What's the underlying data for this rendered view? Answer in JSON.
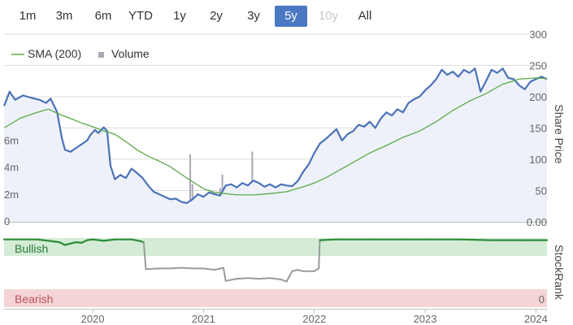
{
  "range_selector": {
    "buttons": [
      "1m",
      "3m",
      "6m",
      "YTD",
      "1y",
      "2y",
      "3y",
      "5y",
      "10y",
      "All"
    ],
    "active": "5y",
    "disabled": [
      "10y"
    ],
    "active_color": "#4a78c2"
  },
  "legend": {
    "sma_label": "SMA (200)",
    "volume_label": "Volume",
    "sma_color": "#5aaa46",
    "volume_color": "#a9aab3"
  },
  "price_axis": {
    "title": "Share Price",
    "ticks": [
      "300",
      "250",
      "200",
      "150",
      "100",
      "50",
      "0.00"
    ]
  },
  "volume_axis": {
    "ticks": [
      "6m",
      "4m",
      "2m",
      "0"
    ]
  },
  "stockrank_panel": {
    "title": "StockRank",
    "bullish_label": "Bullish",
    "bearish_label": "Bearish",
    "min_label": "0",
    "bullish_color": "#d4ecd6",
    "bearish_color": "#f4d4d6",
    "bullish_line_color": "#2e8a3a",
    "bearish_line_color": "#9a9a9a"
  },
  "x_axis": {
    "labels": [
      "2020",
      "2021",
      "2022",
      "2023",
      "2024"
    ]
  },
  "colors": {
    "price_line": "#4a72b8",
    "price_fill": "#eef1f9",
    "grid": "#dcdcdc"
  },
  "chart_data": {
    "type": "line",
    "x_range": [
      2019.2,
      2024.1
    ],
    "price_ylim": [
      0,
      300
    ],
    "volume_ylim": [
      0,
      8000000
    ],
    "stockrank_ylim": [
      0,
      100
    ],
    "series": [
      {
        "name": "Share Price",
        "points": [
          [
            2019.2,
            185
          ],
          [
            2019.25,
            208
          ],
          [
            2019.3,
            195
          ],
          [
            2019.37,
            202
          ],
          [
            2019.45,
            198
          ],
          [
            2019.52,
            195
          ],
          [
            2019.58,
            190
          ],
          [
            2019.62,
            197
          ],
          [
            2019.68,
            175
          ],
          [
            2019.72,
            135
          ],
          [
            2019.75,
            115
          ],
          [
            2019.8,
            112
          ],
          [
            2019.85,
            118
          ],
          [
            2019.9,
            124
          ],
          [
            2019.95,
            130
          ],
          [
            2019.98,
            139
          ],
          [
            2020.02,
            147
          ],
          [
            2020.05,
            142
          ],
          [
            2020.1,
            151
          ],
          [
            2020.13,
            145
          ],
          [
            2020.16,
            90
          ],
          [
            2020.2,
            68
          ],
          [
            2020.25,
            75
          ],
          [
            2020.3,
            70
          ],
          [
            2020.35,
            85
          ],
          [
            2020.4,
            78
          ],
          [
            2020.45,
            70
          ],
          [
            2020.5,
            58
          ],
          [
            2020.55,
            48
          ],
          [
            2020.6,
            44
          ],
          [
            2020.65,
            40
          ],
          [
            2020.7,
            36
          ],
          [
            2020.75,
            37
          ],
          [
            2020.8,
            32
          ],
          [
            2020.85,
            30
          ],
          [
            2020.9,
            36
          ],
          [
            2020.95,
            44
          ],
          [
            2021.0,
            40
          ],
          [
            2021.05,
            47
          ],
          [
            2021.1,
            44
          ],
          [
            2021.15,
            42
          ],
          [
            2021.2,
            58
          ],
          [
            2021.25,
            60
          ],
          [
            2021.3,
            55
          ],
          [
            2021.35,
            62
          ],
          [
            2021.4,
            58
          ],
          [
            2021.45,
            66
          ],
          [
            2021.5,
            62
          ],
          [
            2021.55,
            56
          ],
          [
            2021.6,
            60
          ],
          [
            2021.65,
            55
          ],
          [
            2021.7,
            60
          ],
          [
            2021.75,
            58
          ],
          [
            2021.8,
            57
          ],
          [
            2021.85,
            65
          ],
          [
            2021.9,
            80
          ],
          [
            2021.95,
            92
          ],
          [
            2022.0,
            110
          ],
          [
            2022.05,
            125
          ],
          [
            2022.1,
            132
          ],
          [
            2022.15,
            140
          ],
          [
            2022.2,
            148
          ],
          [
            2022.25,
            130
          ],
          [
            2022.3,
            140
          ],
          [
            2022.35,
            145
          ],
          [
            2022.4,
            155
          ],
          [
            2022.45,
            152
          ],
          [
            2022.5,
            160
          ],
          [
            2022.55,
            150
          ],
          [
            2022.6,
            165
          ],
          [
            2022.65,
            175
          ],
          [
            2022.7,
            170
          ],
          [
            2022.75,
            180
          ],
          [
            2022.8,
            175
          ],
          [
            2022.85,
            190
          ],
          [
            2022.9,
            196
          ],
          [
            2022.95,
            200
          ],
          [
            2023.0,
            210
          ],
          [
            2023.05,
            218
          ],
          [
            2023.1,
            228
          ],
          [
            2023.15,
            243
          ],
          [
            2023.2,
            235
          ],
          [
            2023.25,
            240
          ],
          [
            2023.3,
            232
          ],
          [
            2023.35,
            243
          ],
          [
            2023.4,
            238
          ],
          [
            2023.45,
            245
          ],
          [
            2023.5,
            208
          ],
          [
            2023.55,
            225
          ],
          [
            2023.6,
            243
          ],
          [
            2023.65,
            238
          ],
          [
            2023.7,
            245
          ],
          [
            2023.75,
            230
          ],
          [
            2023.8,
            228
          ],
          [
            2023.85,
            218
          ],
          [
            2023.9,
            212
          ],
          [
            2023.95,
            224
          ],
          [
            2024.0,
            228
          ],
          [
            2024.05,
            232
          ],
          [
            2024.1,
            228
          ]
        ]
      },
      {
        "name": "SMA (200)",
        "points": [
          [
            2019.2,
            150
          ],
          [
            2019.35,
            166
          ],
          [
            2019.5,
            175
          ],
          [
            2019.6,
            180
          ],
          [
            2019.7,
            172
          ],
          [
            2019.8,
            165
          ],
          [
            2019.9,
            158
          ],
          [
            2020.0,
            152
          ],
          [
            2020.1,
            145
          ],
          [
            2020.2,
            140
          ],
          [
            2020.3,
            128
          ],
          [
            2020.4,
            115
          ],
          [
            2020.5,
            105
          ],
          [
            2020.6,
            97
          ],
          [
            2020.7,
            88
          ],
          [
            2020.8,
            76
          ],
          [
            2020.9,
            64
          ],
          [
            2021.0,
            53
          ],
          [
            2021.1,
            47
          ],
          [
            2021.2,
            45
          ],
          [
            2021.3,
            43
          ],
          [
            2021.45,
            43
          ],
          [
            2021.6,
            45
          ],
          [
            2021.75,
            48
          ],
          [
            2021.9,
            56
          ],
          [
            2022.0,
            62
          ],
          [
            2022.1,
            70
          ],
          [
            2022.2,
            80
          ],
          [
            2022.35,
            95
          ],
          [
            2022.5,
            110
          ],
          [
            2022.65,
            122
          ],
          [
            2022.8,
            135
          ],
          [
            2022.95,
            145
          ],
          [
            2023.1,
            160
          ],
          [
            2023.25,
            178
          ],
          [
            2023.4,
            193
          ],
          [
            2023.55,
            205
          ],
          [
            2023.7,
            220
          ],
          [
            2023.85,
            228
          ],
          [
            2024.0,
            230
          ],
          [
            2024.1,
            229
          ]
        ]
      },
      {
        "name": "Volume",
        "bars": [
          [
            2019.25,
            0.3
          ],
          [
            2019.3,
            0.2
          ],
          [
            2019.45,
            0.3
          ],
          [
            2019.55,
            0.2
          ],
          [
            2019.7,
            0.4
          ],
          [
            2019.75,
            0.25
          ],
          [
            2019.85,
            0.3
          ],
          [
            2019.92,
            0.6
          ],
          [
            2020.02,
            0.4
          ],
          [
            2020.12,
            0.5
          ],
          [
            2020.18,
            0.4
          ],
          [
            2020.3,
            0.3
          ],
          [
            2020.38,
            0.3
          ],
          [
            2020.5,
            0.3
          ],
          [
            2020.6,
            0.3
          ],
          [
            2020.72,
            0.3
          ],
          [
            2020.8,
            0.4
          ],
          [
            2020.86,
            1.5
          ],
          [
            2020.88,
            5.0
          ],
          [
            2020.9,
            2.8
          ],
          [
            2020.94,
            1.8
          ],
          [
            2020.97,
            1.2
          ],
          [
            2021.0,
            1.6
          ],
          [
            2021.04,
            2.0
          ],
          [
            2021.1,
            1.0
          ],
          [
            2021.15,
            2.5
          ],
          [
            2021.17,
            3.5
          ],
          [
            2021.2,
            1.5
          ],
          [
            2021.25,
            1.8
          ],
          [
            2021.3,
            0.8
          ],
          [
            2021.35,
            1.2
          ],
          [
            2021.4,
            1.0
          ],
          [
            2021.44,
            5.2
          ],
          [
            2021.47,
            2.0
          ],
          [
            2021.52,
            1.0
          ],
          [
            2021.6,
            0.8
          ],
          [
            2021.7,
            0.5
          ],
          [
            2021.8,
            0.6
          ],
          [
            2021.88,
            0.8
          ],
          [
            2021.95,
            1.2
          ],
          [
            2022.0,
            0.8
          ],
          [
            2022.03,
            1.6
          ],
          [
            2022.04,
            3.5
          ],
          [
            2022.06,
            1.0
          ],
          [
            2022.12,
            0.5
          ],
          [
            2022.2,
            0.4
          ],
          [
            2022.3,
            0.3
          ],
          [
            2022.4,
            0.6
          ],
          [
            2022.47,
            0.3
          ],
          [
            2022.55,
            1.2
          ],
          [
            2022.62,
            0.8
          ],
          [
            2022.7,
            1.5
          ],
          [
            2022.75,
            0.6
          ],
          [
            2022.85,
            1.0
          ],
          [
            2022.95,
            0.3
          ],
          [
            2023.05,
            0.5
          ],
          [
            2023.15,
            0.4
          ],
          [
            2023.25,
            0.7
          ],
          [
            2023.35,
            0.5
          ],
          [
            2023.42,
            1.2
          ],
          [
            2023.46,
            2.2
          ],
          [
            2023.48,
            2.8
          ],
          [
            2023.5,
            1.2
          ],
          [
            2023.55,
            1.3
          ],
          [
            2023.6,
            0.4
          ],
          [
            2023.7,
            0.6
          ],
          [
            2023.8,
            0.3
          ],
          [
            2023.88,
            0.5
          ],
          [
            2023.93,
            0.3
          ],
          [
            2024.0,
            0.4
          ],
          [
            2024.05,
            0.6
          ],
          [
            2024.08,
            0.4
          ]
        ]
      },
      {
        "name": "StockRank",
        "points": [
          [
            2019.2,
            98
          ],
          [
            2019.5,
            98
          ],
          [
            2019.6,
            96
          ],
          [
            2019.7,
            94
          ],
          [
            2019.75,
            90
          ],
          [
            2019.8,
            92
          ],
          [
            2019.85,
            94
          ],
          [
            2019.9,
            93
          ],
          [
            2019.95,
            97
          ],
          [
            2020.0,
            98
          ],
          [
            2020.1,
            96
          ],
          [
            2020.2,
            98
          ],
          [
            2020.35,
            98
          ],
          [
            2020.42,
            96
          ],
          [
            2020.46,
            94
          ],
          [
            2020.48,
            55
          ],
          [
            2020.6,
            56
          ],
          [
            2020.7,
            56
          ],
          [
            2020.8,
            57
          ],
          [
            2020.9,
            56
          ],
          [
            2021.0,
            56
          ],
          [
            2021.1,
            54
          ],
          [
            2021.18,
            57
          ],
          [
            2021.2,
            38
          ],
          [
            2021.3,
            41
          ],
          [
            2021.4,
            42
          ],
          [
            2021.5,
            41
          ],
          [
            2021.6,
            42
          ],
          [
            2021.7,
            40
          ],
          [
            2021.75,
            37
          ],
          [
            2021.8,
            52
          ],
          [
            2021.85,
            54
          ],
          [
            2021.9,
            52
          ],
          [
            2022.0,
            52
          ],
          [
            2022.04,
            56
          ],
          [
            2022.05,
            97
          ],
          [
            2022.2,
            98
          ],
          [
            2022.5,
            98
          ],
          [
            2022.8,
            98
          ],
          [
            2023.0,
            98
          ],
          [
            2023.3,
            98
          ],
          [
            2023.6,
            97
          ],
          [
            2023.9,
            97
          ],
          [
            2024.1,
            97
          ]
        ]
      }
    ]
  }
}
